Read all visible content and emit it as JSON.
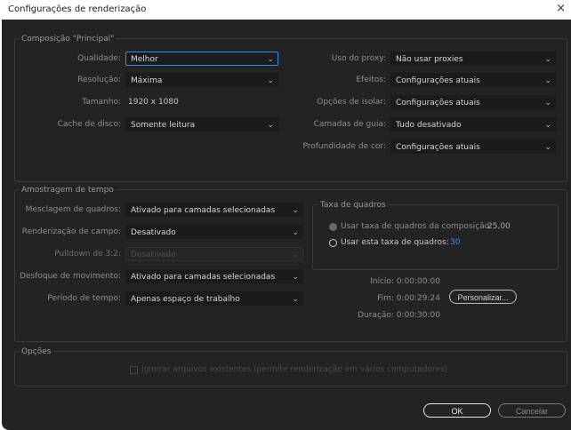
{
  "window": {
    "title": "Configurações de renderização",
    "close_glyph": "×"
  },
  "composition": {
    "legend": "Composição \"Principal\"",
    "quality": {
      "label": "Qualidade:",
      "value": "Melhor"
    },
    "resolution": {
      "label": "Resolução:",
      "value": "Máxima"
    },
    "size": {
      "label": "Tamanho:",
      "value": "1920 x 1080"
    },
    "disk_cache": {
      "label": "Cache de disco:",
      "value": "Somente leitura"
    },
    "proxy_use": {
      "label": "Uso do proxy:",
      "value": "Não usar proxies"
    },
    "effects": {
      "label": "Efeitos:",
      "value": "Configurações atuais"
    },
    "solo_switches": {
      "label": "Opções de isolar:",
      "value": "Configurações atuais"
    },
    "guide_layers": {
      "label": "Camadas de guia:",
      "value": "Tudo desativado"
    },
    "color_depth": {
      "label": "Profundidade de cor:",
      "value": "Configurações atuais"
    }
  },
  "time_sampling": {
    "legend": "Amostragem de tempo",
    "frame_blending": {
      "label": "Mesclagem de quadros:",
      "value": "Ativado para camadas selecionadas"
    },
    "field_render": {
      "label": "Renderização de campo:",
      "value": "Desativado"
    },
    "pulldown": {
      "label": "Pulldown de 3:2:",
      "value": "Desativado"
    },
    "motion_blur": {
      "label": "Desfoque de movimento:",
      "value": "Ativado para camadas selecionadas"
    },
    "time_span": {
      "label": "Período de tempo:",
      "value": "Apenas espaço de trabalho"
    },
    "frame_rate": {
      "legend": "Taxa de quadros",
      "use_comp_rate": {
        "label": "Usar taxa de quadros da composição",
        "value": "25,00"
      },
      "use_this_rate": {
        "label": "Usar esta taxa de quadros:",
        "value": "30"
      }
    },
    "start": "Início: 0:00:00:00",
    "end": "Fim: 0:00:29:24",
    "duration": "Duração: 0:00:30:00",
    "customize_button": "Personalizar..."
  },
  "options": {
    "legend": "Opções",
    "skip_existing": "Ignorar arquivos existentes (permite renderização em vários computadores)"
  },
  "buttons": {
    "ok": "OK",
    "cancel": "Cancelar"
  },
  "icons": {
    "dropdown": "chevron-down-icon",
    "close": "close-icon"
  },
  "colors": {
    "accent": "#2d8ceb",
    "link_value": "#3d8fe0",
    "dialog_bg": "#232323"
  }
}
